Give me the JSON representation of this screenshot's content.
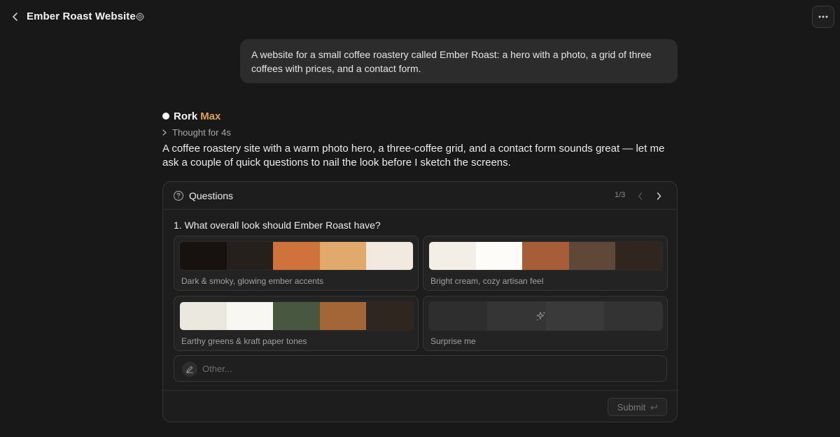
{
  "header": {
    "title": "Ember Roast Website",
    "back_icon": "chevron-left-icon",
    "settings_icon": "gear-icon",
    "more_icon": "more-horizontal-icon"
  },
  "user_message": {
    "text": "A website for a small coffee roastery called Ember Roast: a hero with a photo, a grid of three coffees with prices, and a contact form."
  },
  "assistant": {
    "name": "Rork",
    "name_accent": "Max",
    "accent_color": "#e0a050",
    "thought_label": "Thought for 4s",
    "reply": "A coffee roastery site with a warm photo hero, a three-coffee grid, and a contact form sounds great — let me ask a couple of quick questions to nail the look before I sketch the screens."
  },
  "questions": {
    "title": "Questions",
    "page_indicator": "1/3",
    "question": "1. What overall look should Ember Roast have?",
    "options": [
      {
        "label": "Dark & smoky, glowing ember accents",
        "colors": [
          "#17120f",
          "#25201c",
          "#cf723c",
          "#e2a96c",
          "#f2e9df"
        ]
      },
      {
        "label": "Bright cream, cozy artisan feel",
        "colors": [
          "#f3efe6",
          "#fdfcf9",
          "#a75e38",
          "#5f4838",
          "#30261f"
        ]
      },
      {
        "label": "Earthy greens & kraft paper tones",
        "colors": [
          "#ebe8df",
          "#f9f7f1",
          "#485840",
          "#a26637",
          "#2f261f"
        ]
      },
      {
        "label": "Surprise me",
        "colors": [
          "#2e2e2e",
          "#353535",
          "#3a3a3a",
          "#333333"
        ]
      }
    ],
    "other_placeholder": "Other...",
    "submit_label": "Submit"
  }
}
